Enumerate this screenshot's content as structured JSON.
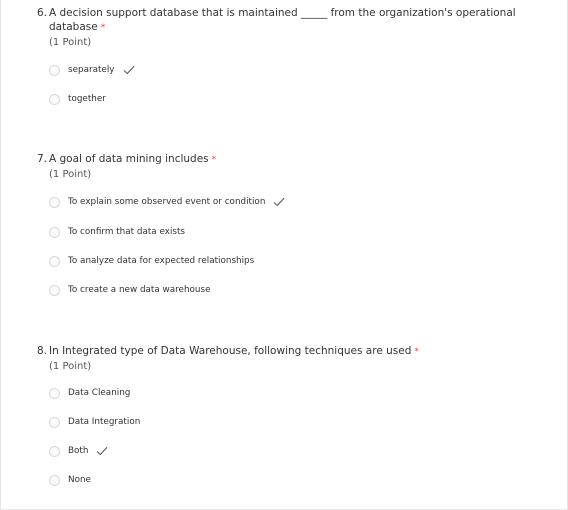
{
  "questions": [
    {
      "number": "6.",
      "text_line1": "A decision support database that is maintained _____ from the organization's operational",
      "text_line2": "database",
      "required_mark": "*",
      "points": "(1 Point)",
      "options": [
        {
          "label": "separately",
          "correct": true
        },
        {
          "label": "together",
          "correct": false
        }
      ]
    },
    {
      "number": "7.",
      "text_line1": "A goal of data mining includes",
      "required_mark": "*",
      "points": "(1 Point)",
      "options": [
        {
          "label": "To explain some observed event or condition",
          "correct": true
        },
        {
          "label": "To confirm that data exists",
          "correct": false
        },
        {
          "label": "To analyze data for expected relationships",
          "correct": false
        },
        {
          "label": "To create a new data warehouse",
          "correct": false
        }
      ]
    },
    {
      "number": "8.",
      "text_line1": "In Integrated type of Data Warehouse, following techniques are used",
      "required_mark": "*",
      "points": "(1 Point)",
      "options": [
        {
          "label": "Data Cleaning",
          "correct": false
        },
        {
          "label": "Data Integration",
          "correct": false
        },
        {
          "label": "Both",
          "correct": true
        },
        {
          "label": "None",
          "correct": false
        }
      ]
    }
  ],
  "colors": {
    "required": "#e04a4a",
    "check": "#5a5a5a",
    "radio_border": "#d9d9d9"
  },
  "icons": {
    "correct": "check-icon",
    "radio": "radio-circle-icon"
  }
}
